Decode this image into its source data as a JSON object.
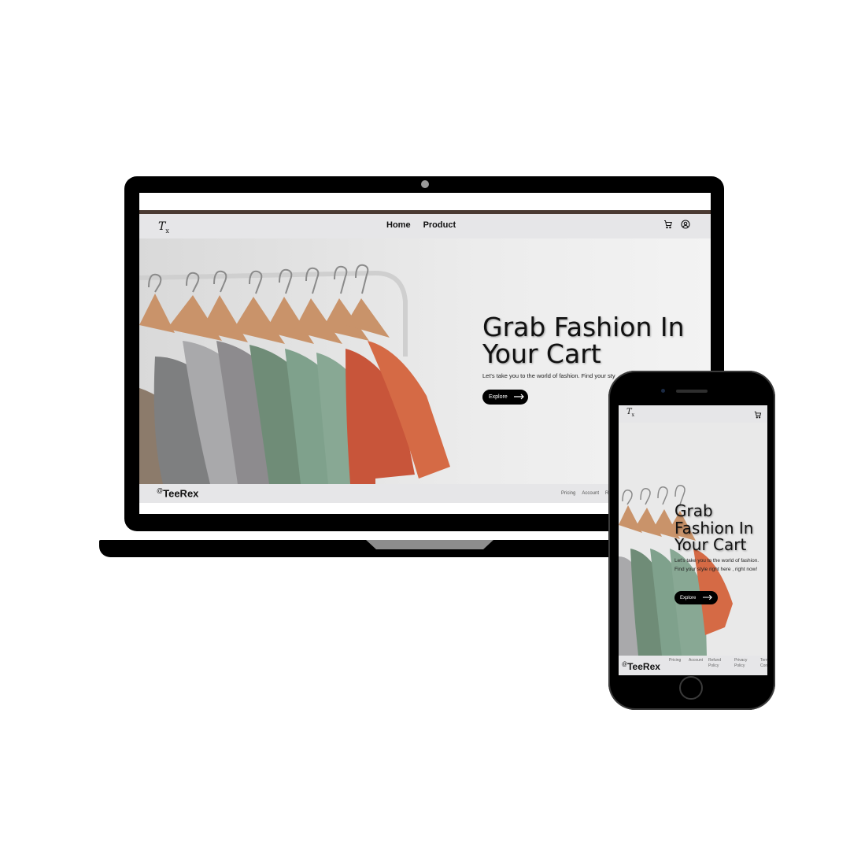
{
  "brand": {
    "logo_glyph": "T",
    "logo_sub": "x",
    "name": "TeeRex",
    "name_prefix": "@"
  },
  "nav": {
    "items": [
      "Home",
      "Product"
    ],
    "cart_icon": "cart-icon",
    "account_icon": "user-circle-icon"
  },
  "hero": {
    "title": "Grab Fashion In Your Cart",
    "subtitle_desktop": "Let's take you to the world of fashion. Find your sty",
    "subtitle_mobile": "Let's take you to the world of fashion. Find your style right here , right now!",
    "button_label": "Explore",
    "button_icon": "arrow-right-icon"
  },
  "footer": {
    "links_desktop": [
      "Pricing",
      "Account",
      "Refu"
    ],
    "links_mobile": [
      "Pricing",
      "Account",
      "Refund Policy",
      "Privacy Policy",
      "Terms Condi"
    ]
  },
  "colors": {
    "nav_bg": "#e6e6e8",
    "accent_bar": "#4a3a32",
    "button_bg": "#000000",
    "shirts": [
      "#8c7b6b",
      "#7e7f80",
      "#a9a9ab",
      "#8d8b8e",
      "#6f8c77",
      "#7fa18c",
      "#88a894",
      "#c8553a",
      "#d56a45"
    ]
  }
}
